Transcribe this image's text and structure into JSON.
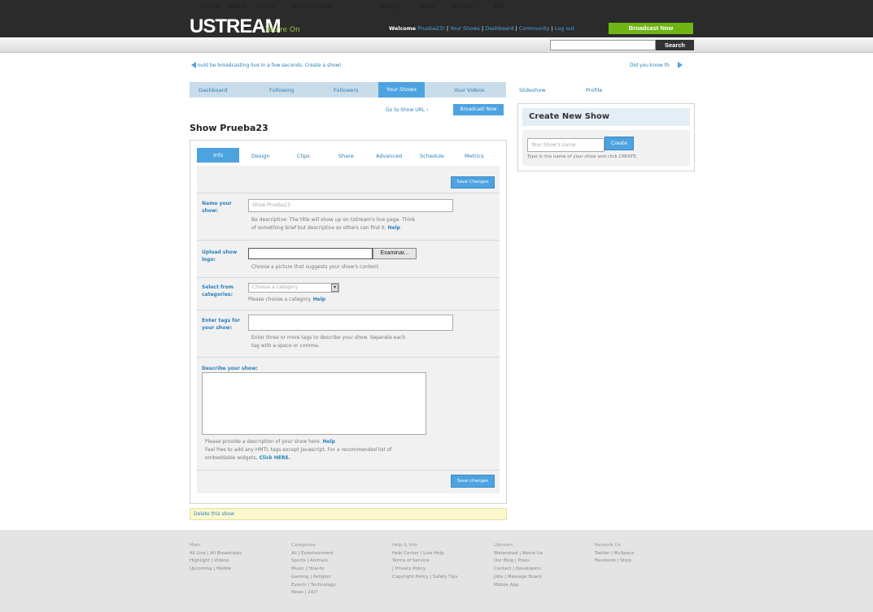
{
  "header": {
    "logo": "USTREAM",
    "tagline": "You're On",
    "welcome": "Welcome",
    "username": "Prueba23!",
    "links": [
      "Your Shows",
      "Dashboard",
      "Community",
      "Log out"
    ],
    "broadcast_now": "Broadcast Now"
  },
  "categories": [
    "All Live",
    "Mobile",
    "Sports",
    "Entertainment",
    "Gaming",
    "News",
    "Animals",
    "24/7"
  ],
  "search": {
    "button": "Search",
    "value": ""
  },
  "promo": {
    "left": "ould be broadcasting live in a few seconds. Create a show!",
    "right": "Did you know th"
  },
  "user_tabs": [
    {
      "label": "Dashboard"
    },
    {
      "label": "Following"
    },
    {
      "label": "Followers"
    },
    {
      "label": "Your Shows",
      "active": true
    },
    {
      "label": "Your Videos"
    },
    {
      "label": "Slideshow"
    },
    {
      "label": "Profile"
    }
  ],
  "show_actions": {
    "goto": "Go to Show URL ›",
    "broadcast": "Broadcast Now"
  },
  "show_title": "Show Prueba23",
  "show_tabs": [
    {
      "label": "Info",
      "active": true
    },
    {
      "label": "Design"
    },
    {
      "label": "Clips"
    },
    {
      "label": "Share"
    },
    {
      "label": "Advanced"
    },
    {
      "label": "Schedule"
    },
    {
      "label": "Metrics"
    }
  ],
  "form": {
    "save_top": "Save Changes",
    "save_bottom": "Save changes",
    "name": {
      "label": "Name your show:",
      "placeholder": "Show Prueba23",
      "help1": "Be descriptive: The title will show up on Ustream's live page. Think",
      "help2": "of something brief but descriptive so others can find it.",
      "help_link": "Help"
    },
    "logo": {
      "label": "Upload show logo:",
      "button": "Examinar...",
      "help": "Choose a picture that suggests your show's content."
    },
    "category": {
      "label": "Select from categories:",
      "selected": "Choose a category",
      "help": "Please choose a category.",
      "help_link": "Help"
    },
    "tags": {
      "label": "Enter tags for your show:",
      "help1": "Enter three or more tags to describe your show. Separate each",
      "help2": "tag with a space or comma."
    },
    "describe": {
      "label": "Describe your show:",
      "help1": "Please provide a description of your show here.",
      "help_link": "Help",
      "help2": "Feel free to add any HMTL tags except Javascript. For a recommended list of",
      "help3": "embeddable widgets,",
      "click_here": "Click HERE."
    }
  },
  "delete": "Delete this show",
  "create_show": {
    "title": "Create New Show",
    "placeholder": "Your Show's name",
    "button": "Create",
    "help": "Type in the name of your show and click CREATE."
  },
  "footer": [
    {
      "title": "Main",
      "lines": [
        "All Live | All Broadcasts",
        "Highlight | Videos",
        "Upcoming | Mobile"
      ]
    },
    {
      "title": "Categories",
      "lines": [
        "All | Entertainment",
        "Sports | Animals",
        "Music | How-to",
        "Gaming | Religion",
        "Events | Technology",
        "News | 24/7"
      ]
    },
    {
      "title": "Help & Info",
      "lines": [
        "Help Center | Live Help",
        "Terms of Service",
        "| Privacy Policy",
        "Copyright Policy | Safety Tips"
      ]
    },
    {
      "title": "Ustream",
      "lines": [
        "Watershed | About Us",
        "Our Blog | Press",
        "Contact | Developers",
        "Jobs | Message Board",
        "Mobile App"
      ]
    },
    {
      "title": "Network Us",
      "lines": [
        "Twitter | MySpace",
        "Facebook | Shop"
      ]
    }
  ]
}
